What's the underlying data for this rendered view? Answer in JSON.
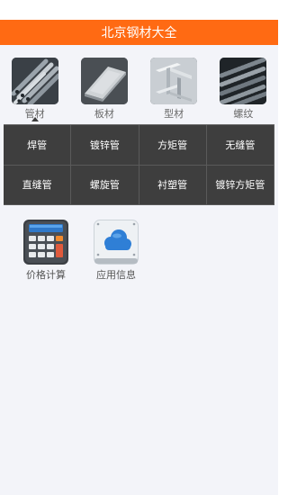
{
  "header": {
    "title": "北京钢材大全"
  },
  "categories": [
    {
      "label": "管材",
      "icon": "steel-pipes-icon",
      "selected": true
    },
    {
      "label": "板材",
      "icon": "steel-plate-icon",
      "selected": false
    },
    {
      "label": "型材",
      "icon": "steel-beam-icon",
      "selected": false
    },
    {
      "label": "螺纹",
      "icon": "rebar-icon",
      "selected": false
    }
  ],
  "subcategories": [
    "焊管",
    "镀锌管",
    "方矩管",
    "无缝管",
    "直缝管",
    "螺旋管",
    "衬塑管",
    "镀锌方矩管"
  ],
  "tools": [
    {
      "label": "价格计算",
      "icon": "calculator-icon"
    },
    {
      "label": "应用信息",
      "icon": "cloud-info-icon"
    }
  ],
  "colors": {
    "titlebar": "#ff6a13",
    "background": "#f3f4f9",
    "subgrid": "#3e3e3e"
  }
}
